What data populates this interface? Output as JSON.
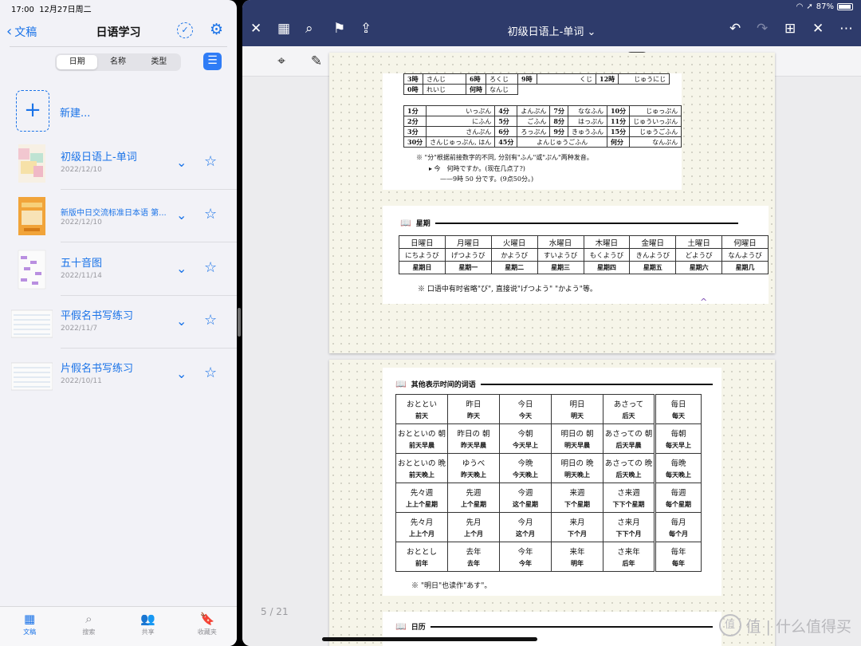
{
  "status": {
    "time": "17:00",
    "date": "12月27日周二",
    "battery": "87%"
  },
  "left": {
    "back_label": "文稿",
    "title": "日语学习",
    "segments": [
      "日期",
      "名称",
      "类型"
    ],
    "new_label": "新建...",
    "documents": [
      {
        "name": "初级日语上-单词",
        "date": "2022/12/10"
      },
      {
        "name": "新版中日交流标准日本语 第...",
        "date": "2022/12/10"
      },
      {
        "name": "五十音图",
        "date": "2022/11/14"
      },
      {
        "name": "平假名书写练习",
        "date": "2022/11/7"
      },
      {
        "name": "片假名书写练习",
        "date": "2022/10/11"
      }
    ],
    "tabs": [
      "文稿",
      "搜索",
      "共享",
      "收藏夹"
    ]
  },
  "right": {
    "doc_title": "初级日语上-单词",
    "page_indicator": "5 / 21",
    "time_table": {
      "rows_top": [
        [
          "3時",
          "さんじ",
          "6時",
          "ろくじ",
          "9時",
          "くじ",
          "12時",
          "じゅうにじ"
        ],
        [
          "0時",
          "れいじ",
          "何時",
          "なんじ",
          "",
          "",
          "",
          ""
        ]
      ],
      "rows_min": [
        [
          "1分",
          "いっぷん",
          "4分",
          "よんぷん",
          "7分",
          "ななふん",
          "10分",
          "じゅっぷん"
        ],
        [
          "2分",
          "にふん",
          "5分",
          "ごふん",
          "8分",
          "はっぷん",
          "11分",
          "じゅういっぷん"
        ],
        [
          "3分",
          "さんぷん",
          "6分",
          "ろっぷん",
          "9分",
          "きゅうふん",
          "15分",
          "じゅうごふん"
        ],
        [
          "30分",
          "さんじゅっぷん, はん",
          "45分",
          "よんじゅうごふん",
          "",
          "",
          "何分",
          "なんぷん"
        ]
      ],
      "note1": "※ \"分\"根据前接数字的不同, 分别有\"ふん\"或\"ぷん\"两种发音。",
      "example1": "▸ 今　何時ですか。(现在几点了?)",
      "example2": "——9時 50 分です。(9点50分。)"
    },
    "week": {
      "heading": "星期",
      "days_jp": [
        "日曜日",
        "月曜日",
        "火曜日",
        "水曜日",
        "木曜日",
        "金曜日",
        "土曜日",
        "何曜日"
      ],
      "days_kana": [
        "にちようび",
        "げつようび",
        "かようび",
        "すいようび",
        "もくようび",
        "きんようび",
        "どようび",
        "なんようび"
      ],
      "days_cn": [
        "星期日",
        "星期一",
        "星期二",
        "星期三",
        "星期四",
        "星期五",
        "星期六",
        "星期几"
      ],
      "note": "※ 口语中有时省略\"び\", 直接说\"げつよう\" \"かよう\"等。"
    },
    "time_words": {
      "heading": "其他表示时间的词语",
      "rows": [
        [
          [
            "おととい",
            "前天"
          ],
          [
            "昨日",
            "昨天"
          ],
          [
            "今日",
            "今天"
          ],
          [
            "明日",
            "明天"
          ],
          [
            "あさって",
            "后天"
          ],
          [
            "毎日",
            "每天"
          ]
        ],
        [
          [
            "おとといの 朝",
            "前天早晨"
          ],
          [
            "昨日の 朝",
            "昨天早晨"
          ],
          [
            "今朝",
            "今天早上"
          ],
          [
            "明日の 朝",
            "明天早晨"
          ],
          [
            "あさっての 朝",
            "后天早晨"
          ],
          [
            "毎朝",
            "每天早上"
          ]
        ],
        [
          [
            "おとといの 晩",
            "前天晚上"
          ],
          [
            "ゆうべ",
            "昨天晚上"
          ],
          [
            "今晩",
            "今天晚上"
          ],
          [
            "明日の 晩",
            "明天晚上"
          ],
          [
            "あさっての 晩",
            "后天晚上"
          ],
          [
            "毎晩",
            "每天晚上"
          ]
        ],
        [
          [
            "先々週",
            "上上个星期"
          ],
          [
            "先週",
            "上个星期"
          ],
          [
            "今週",
            "这个星期"
          ],
          [
            "来週",
            "下个星期"
          ],
          [
            "さ来週",
            "下下个星期"
          ],
          [
            "毎週",
            "每个星期"
          ]
        ],
        [
          [
            "先々月",
            "上上个月"
          ],
          [
            "先月",
            "上个月"
          ],
          [
            "今月",
            "这个月"
          ],
          [
            "来月",
            "下个月"
          ],
          [
            "さ来月",
            "下下个月"
          ],
          [
            "毎月",
            "每个月"
          ]
        ],
        [
          [
            "おととし",
            "前年"
          ],
          [
            "去年",
            "去年"
          ],
          [
            "今年",
            "今年"
          ],
          [
            "来年",
            "明年"
          ],
          [
            "さ来年",
            "后年"
          ],
          [
            "毎年",
            "每年"
          ]
        ]
      ],
      "note": "※ \"明日\"也读作\"あす\"。"
    },
    "calendar_heading": "日历"
  },
  "watermark": "值 | 什么值得买"
}
